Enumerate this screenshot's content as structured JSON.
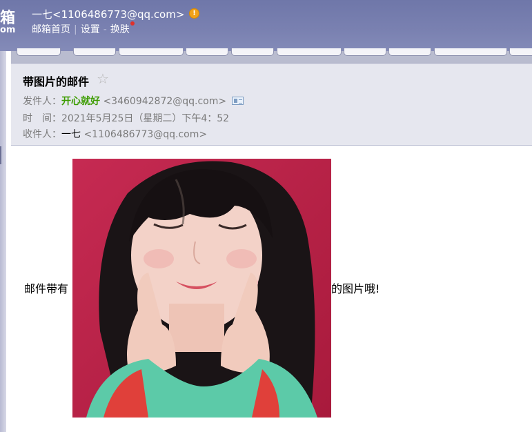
{
  "header": {
    "logo_main": "箱",
    "logo_sub": "om",
    "account": "一七<1106486773@qq.com>",
    "warn_glyph": "!",
    "links": {
      "home": "邮箱首页",
      "settings": "设置",
      "skin": "换肤"
    },
    "separator": "|",
    "separator2": "-"
  },
  "mail": {
    "subject": "带图片的邮件",
    "star": "☆",
    "from_label": "发件人：",
    "from_name": "开心就好",
    "from_addr": "<3460942872@qq.com>",
    "time_label": "时　间：",
    "time_value": "2021年5月25日（星期二）下午4：52",
    "to_label": "收件人：",
    "to_name": "一七",
    "to_addr": "<1106486773@qq.com>"
  },
  "body": {
    "text_before": "邮件带有",
    "text_after": "的图片哦!"
  },
  "colors": {
    "header_bg": "#7a81b1",
    "sender_name": "#3c9c00",
    "photo_bg": "#c0244c"
  }
}
